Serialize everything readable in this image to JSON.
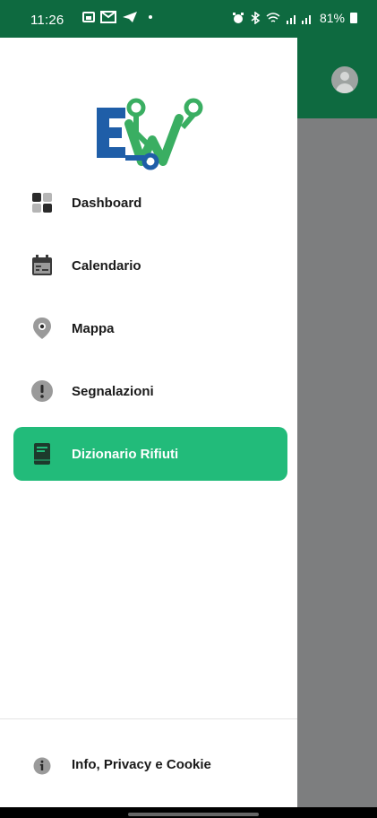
{
  "status_bar": {
    "time": "11:26",
    "battery": "81%"
  },
  "drawer": {
    "logo_text": "EW",
    "items": [
      {
        "label": "Dashboard",
        "icon": "grid-icon",
        "active": false
      },
      {
        "label": "Calendario",
        "icon": "calendar-icon",
        "active": false
      },
      {
        "label": "Mappa",
        "icon": "map-pin-icon",
        "active": false
      },
      {
        "label": "Segnalazioni",
        "icon": "alert-icon",
        "active": false
      },
      {
        "label": "Dizionario Rifiuti",
        "icon": "book-icon",
        "active": true
      }
    ],
    "footer": {
      "label": "Info, Privacy e Cookie",
      "icon": "info-icon"
    }
  },
  "colors": {
    "primary_dark": "#0e6a40",
    "active_item": "#22bb7a",
    "logo_blue": "#1f5ea8",
    "logo_green": "#3aae62"
  }
}
